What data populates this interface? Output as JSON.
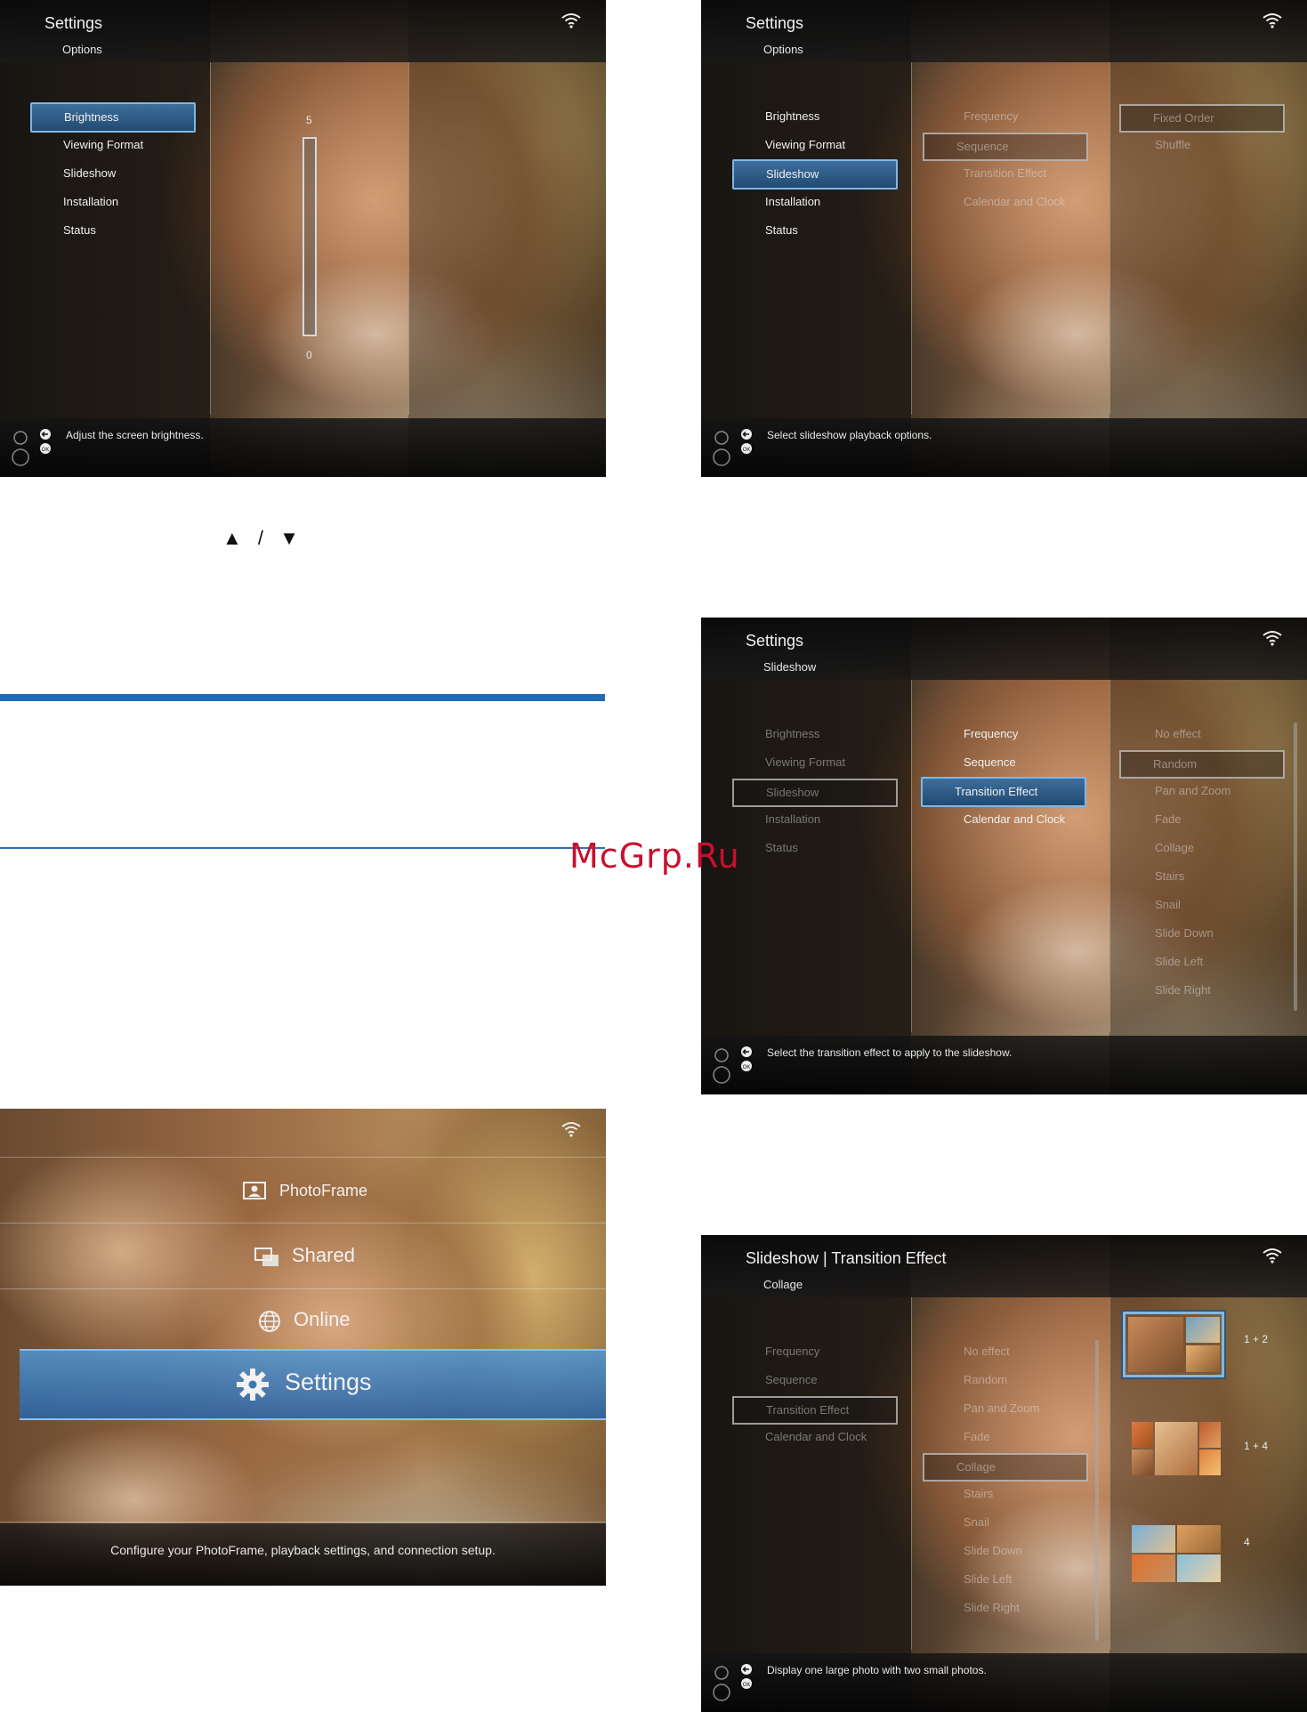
{
  "watermark": "McGrp.Ru",
  "screen1": {
    "title": "Settings",
    "subtitle": "Options",
    "menu": [
      "Brightness",
      "Viewing Format",
      "Slideshow",
      "Installation",
      "Status"
    ],
    "selected_index": 0,
    "slider": {
      "max_label": "5",
      "min_label": "0",
      "level": 0
    },
    "help": "Adjust the screen brightness."
  },
  "screen2": {
    "title": "Settings",
    "subtitle": "Options",
    "menu": [
      "Brightness",
      "Viewing Format",
      "Slideshow",
      "Installation",
      "Status"
    ],
    "submenu": [
      "Frequency",
      "Sequence",
      "Transition Effect",
      "Calendar and Clock"
    ],
    "options": [
      "Fixed Order",
      "Shuffle"
    ],
    "help": "Select slideshow playback options."
  },
  "screen3": {
    "title": "Settings",
    "subtitle": "Slideshow",
    "menu": [
      "Brightness",
      "Viewing Format",
      "Slideshow",
      "Installation",
      "Status"
    ],
    "submenu": [
      "Frequency",
      "Sequence",
      "Transition Effect",
      "Calendar and Clock"
    ],
    "options": [
      "No effect",
      "Random",
      "Pan and Zoom",
      "Fade",
      "Collage",
      "Stairs",
      "Snail",
      "Slide Down",
      "Slide Left",
      "Slide Right"
    ],
    "help": "Select the transition effect to apply to the slideshow."
  },
  "screen4": {
    "title": "Slideshow | Transition Effect",
    "subtitle": "Collage",
    "menu": [
      "Frequency",
      "Sequence",
      "Transition Effect",
      "Calendar and Clock"
    ],
    "submenu": [
      "No effect",
      "Random",
      "Pan and Zoom",
      "Fade",
      "Collage",
      "Stairs",
      "Snail",
      "Slide Down",
      "Slide Left",
      "Slide Right"
    ],
    "layouts": [
      "1 + 2",
      "1 + 4",
      "4"
    ],
    "help": "Display one large photo with two small photos."
  },
  "home": {
    "items": [
      "PhotoFrame",
      "Shared",
      "Online",
      "Settings"
    ],
    "selected_index": 3,
    "help": "Configure your PhotoFrame, playback settings, and connection setup."
  },
  "page": {
    "nav_arrows": "▲ / ▼"
  },
  "colors": {
    "selection": "#3d6f9c",
    "selection_border": "#7fb8e6",
    "rule_blue": "#1f6bb8",
    "watermark": "#c8102e"
  }
}
